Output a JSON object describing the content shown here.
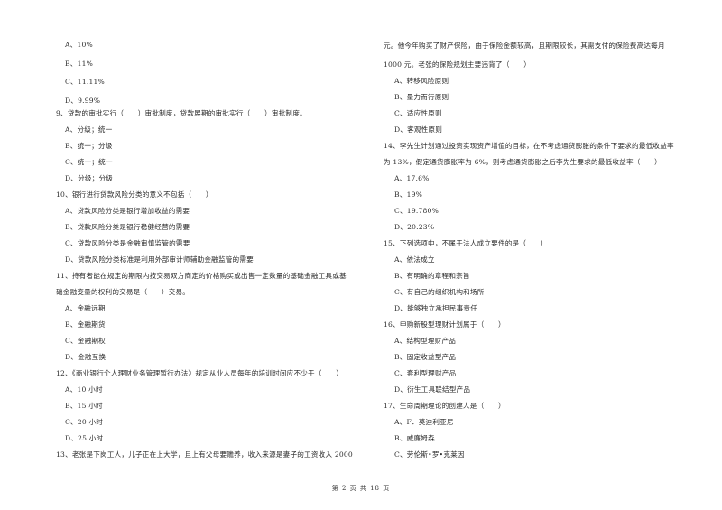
{
  "page": {
    "footer": "第 2 页 共 18 页"
  },
  "left": {
    "q8_options": [
      "A、10%",
      "B、11%",
      "C、11.11%",
      "D、9.99%"
    ],
    "q9": {
      "stem": "9、贷款的审批实行（　　）审批制度，贷款展期的审批实行（　　）审批制度。",
      "options": [
        "A、分级；统一",
        "B、统一；分级",
        "C、统一；统一",
        "D、分级；分级"
      ]
    },
    "q10": {
      "stem": "10、银行进行贷款风险分类的意义不包括（　　）",
      "options": [
        "A、贷款风险分类是银行增加收益的需要",
        "B、贷款风险分类是银行稳健经营的需要",
        "C、贷款风险分类是金融审慎监管的需要",
        "D、贷款风险分类标准是利用外部审计师辅助金融监管的需要"
      ]
    },
    "q11": {
      "stem_line1": "11、持有者能在规定的期限内按交易双方商定的价格购买或出售一定数量的基础金融工具或基",
      "stem_line2": "础金融变量的权利的交易是（　　）交易。",
      "options": [
        "A、金融远期",
        "B、金融期货",
        "C、金融期权",
        "D、金融互换"
      ]
    },
    "q12": {
      "stem": "12、《商业银行个人理财业务管理暂行办法》规定从业人员每年的培训时间应不少于（　　）",
      "options": [
        "A、10 小时",
        "B、15 小时",
        "C、20 小时",
        "D、25 小时"
      ]
    },
    "q13": {
      "stem_line1": "13、老张是下岗工人，儿子正在上大学，且上有父母要赡养，收入来源是妻子的工资收入 2000"
    }
  },
  "right": {
    "q13_cont": {
      "stem_line2": "元。他今年购买了财产保险，由于保险金额较高，且期限较长，其需支付的保险费高达每月",
      "stem_line3": "1000 元。老张的保险规划主要违背了（　　）",
      "options": [
        "A、转移风险原则",
        "B、量力而行原则",
        "C、适应性原则",
        "D、客观性原则"
      ]
    },
    "q14": {
      "stem_line1": "14、李先生计划通过投资实现资产增值的目标，在不考虑通货膨胀的条件下要求的最低收益率",
      "stem_line2": "为 13%，假定通货膨胀率为 6%，则考虑通货膨胀之后李先生要求的最低收益率（　　）",
      "options": [
        "A、17.6%",
        "B、19%",
        "C、19.780%",
        "D、20.23%"
      ]
    },
    "q15": {
      "stem": "15、下列选项中，不属于法人成立要件的是（　　）",
      "options": [
        "A、依法成立",
        "B、有明确的章程和宗旨",
        "C、有自己的组织机构和场所",
        "D、能够独立承担民事责任"
      ]
    },
    "q16": {
      "stem": "16、申购新股型理财计划属于（　　）",
      "options": [
        "A、结构型理财产品",
        "B、固定收益型产品",
        "C、套利型理财产品",
        "D、衍生工具联结型产品"
      ]
    },
    "q17": {
      "stem": "17、生命周期理论的创建人是（　　）",
      "options": [
        "A、F．莫迪利亚尼",
        "B、威廉姆森",
        "C、劳伦斯•罗•克莱因"
      ]
    }
  }
}
